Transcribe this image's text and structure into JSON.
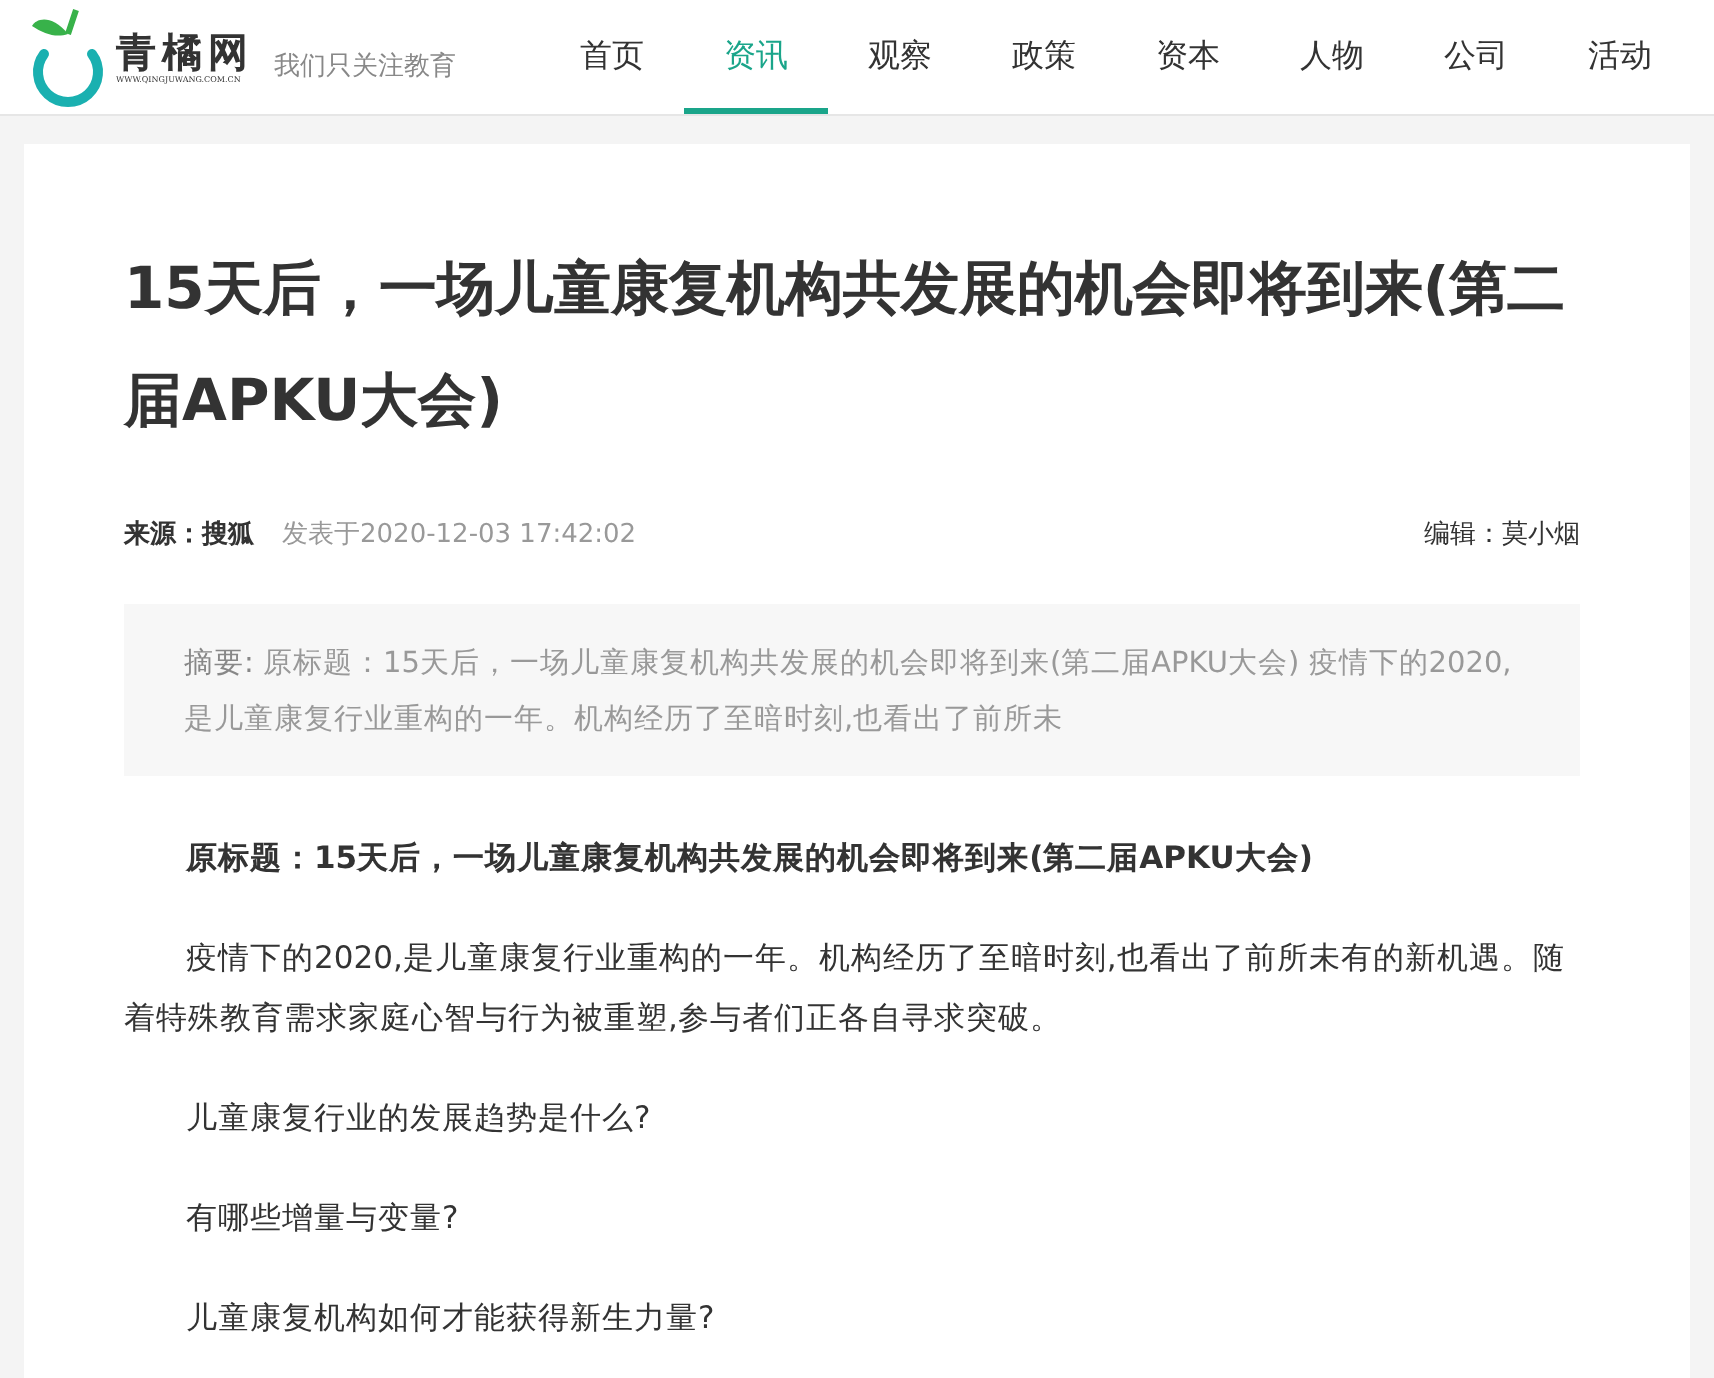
{
  "header": {
    "logo": {
      "name": "青橘网",
      "url": "WWW.QINGJUWANG.COM.CN"
    },
    "slogan": "我们只关注教育"
  },
  "nav": [
    {
      "label": "首页",
      "selected": false
    },
    {
      "label": "资讯",
      "selected": true
    },
    {
      "label": "观察",
      "selected": false
    },
    {
      "label": "政策",
      "selected": false
    },
    {
      "label": "资本",
      "selected": false
    },
    {
      "label": "人物",
      "selected": false
    },
    {
      "label": "公司",
      "selected": false
    },
    {
      "label": "活动",
      "selected": false
    }
  ],
  "article": {
    "title": "15天后，一场儿童康复机构共发展的机会即将到来(第二届APKU大会)",
    "source_label": "来源：",
    "source": "搜狐",
    "published": "发表于2020-12-03 17:42:02",
    "editor": "编辑：莫小烟",
    "summary_label": "摘要:",
    "summary": "原标题：15天后，一场儿童康复机构共发展的机会即将到来(第二届APKU大会) 疫情下的2020,是儿童康复行业重构的一年。机构经历了至暗时刻,也看出了前所未",
    "paragraphs": [
      {
        "kind": "bold",
        "text": "原标题：15天后，一场儿童康复机构共发展的机会即将到来(第二届APKU大会)"
      },
      {
        "kind": "plain",
        "text": "疫情下的2020,是儿童康复行业重构的一年。机构经历了至暗时刻,也看出了前所未有的新机遇。随着特殊教育需求家庭心智与行为被重塑,参与者们正各自寻求突破。"
      },
      {
        "kind": "plain",
        "text": "儿童康复行业的发展趋势是什么?"
      },
      {
        "kind": "plain",
        "text": "有哪些增量与变量?"
      },
      {
        "kind": "plain",
        "text": "儿童康复机构如何才能获得新生力量?"
      }
    ]
  }
}
